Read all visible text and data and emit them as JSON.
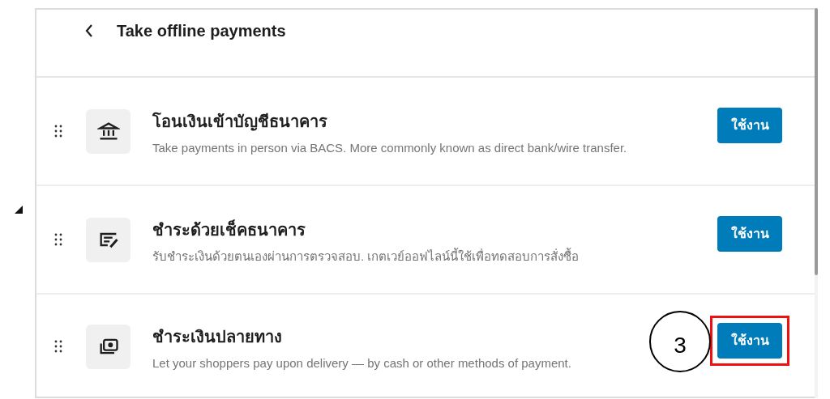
{
  "header": {
    "title": "Take offline payments"
  },
  "methods": [
    {
      "kind": "bank",
      "title": "โอนเงินเข้าบัญชีธนาคาร",
      "description": "Take payments in person via BACS. More commonly known as direct bank/wire transfer.",
      "button": "ใช้งาน",
      "highlighted": false
    },
    {
      "kind": "cheque",
      "title": "ชำระด้วยเช็คธนาคาร",
      "description": "รับชำระเงินด้วยตนเองผ่านการตรวจสอบ. เกตเวย์ออฟไลน์นี้ใช้เพื่อทดสอบการสั่งซื้อ",
      "button": "ใช้งาน",
      "highlighted": false
    },
    {
      "kind": "cash",
      "title": "ชำระเงินปลายทาง",
      "description": "Let your shoppers pay upon delivery — by cash or other methods of payment.",
      "button": "ใช้งาน",
      "highlighted": true
    }
  ],
  "annotation": {
    "label": "3"
  }
}
